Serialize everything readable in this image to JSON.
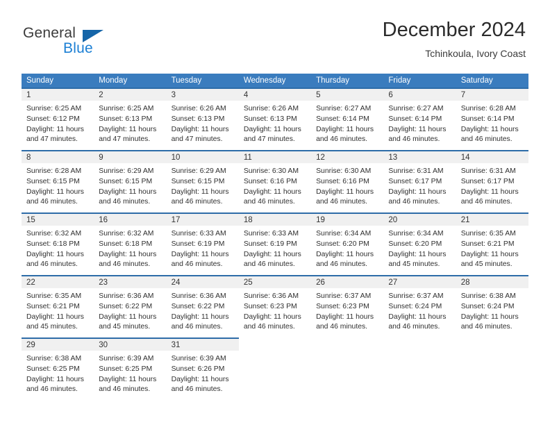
{
  "brand": {
    "name_part1": "General",
    "name_part2": "Blue",
    "logo_icon": "triangle-icon",
    "accent_color": "#1b7fd4",
    "logo_color": "#1565a8"
  },
  "header": {
    "title": "December 2024",
    "subtitle": "Tchinkoula, Ivory Coast"
  },
  "theme": {
    "header_row_bg": "#3a7cbe",
    "row_top_border": "#2d6ca8",
    "daynum_bg": "#f0f0f0",
    "text_color": "#2f2f2f"
  },
  "weekday_headers": [
    "Sunday",
    "Monday",
    "Tuesday",
    "Wednesday",
    "Thursday",
    "Friday",
    "Saturday"
  ],
  "weeks": [
    [
      {
        "day": "1",
        "sunrise": "Sunrise: 6:25 AM",
        "sunset": "Sunset: 6:12 PM",
        "daylight": "Daylight: 11 hours and 47 minutes."
      },
      {
        "day": "2",
        "sunrise": "Sunrise: 6:25 AM",
        "sunset": "Sunset: 6:13 PM",
        "daylight": "Daylight: 11 hours and 47 minutes."
      },
      {
        "day": "3",
        "sunrise": "Sunrise: 6:26 AM",
        "sunset": "Sunset: 6:13 PM",
        "daylight": "Daylight: 11 hours and 47 minutes."
      },
      {
        "day": "4",
        "sunrise": "Sunrise: 6:26 AM",
        "sunset": "Sunset: 6:13 PM",
        "daylight": "Daylight: 11 hours and 47 minutes."
      },
      {
        "day": "5",
        "sunrise": "Sunrise: 6:27 AM",
        "sunset": "Sunset: 6:14 PM",
        "daylight": "Daylight: 11 hours and 46 minutes."
      },
      {
        "day": "6",
        "sunrise": "Sunrise: 6:27 AM",
        "sunset": "Sunset: 6:14 PM",
        "daylight": "Daylight: 11 hours and 46 minutes."
      },
      {
        "day": "7",
        "sunrise": "Sunrise: 6:28 AM",
        "sunset": "Sunset: 6:14 PM",
        "daylight": "Daylight: 11 hours and 46 minutes."
      }
    ],
    [
      {
        "day": "8",
        "sunrise": "Sunrise: 6:28 AM",
        "sunset": "Sunset: 6:15 PM",
        "daylight": "Daylight: 11 hours and 46 minutes."
      },
      {
        "day": "9",
        "sunrise": "Sunrise: 6:29 AM",
        "sunset": "Sunset: 6:15 PM",
        "daylight": "Daylight: 11 hours and 46 minutes."
      },
      {
        "day": "10",
        "sunrise": "Sunrise: 6:29 AM",
        "sunset": "Sunset: 6:15 PM",
        "daylight": "Daylight: 11 hours and 46 minutes."
      },
      {
        "day": "11",
        "sunrise": "Sunrise: 6:30 AM",
        "sunset": "Sunset: 6:16 PM",
        "daylight": "Daylight: 11 hours and 46 minutes."
      },
      {
        "day": "12",
        "sunrise": "Sunrise: 6:30 AM",
        "sunset": "Sunset: 6:16 PM",
        "daylight": "Daylight: 11 hours and 46 minutes."
      },
      {
        "day": "13",
        "sunrise": "Sunrise: 6:31 AM",
        "sunset": "Sunset: 6:17 PM",
        "daylight": "Daylight: 11 hours and 46 minutes."
      },
      {
        "day": "14",
        "sunrise": "Sunrise: 6:31 AM",
        "sunset": "Sunset: 6:17 PM",
        "daylight": "Daylight: 11 hours and 46 minutes."
      }
    ],
    [
      {
        "day": "15",
        "sunrise": "Sunrise: 6:32 AM",
        "sunset": "Sunset: 6:18 PM",
        "daylight": "Daylight: 11 hours and 46 minutes."
      },
      {
        "day": "16",
        "sunrise": "Sunrise: 6:32 AM",
        "sunset": "Sunset: 6:18 PM",
        "daylight": "Daylight: 11 hours and 46 minutes."
      },
      {
        "day": "17",
        "sunrise": "Sunrise: 6:33 AM",
        "sunset": "Sunset: 6:19 PM",
        "daylight": "Daylight: 11 hours and 46 minutes."
      },
      {
        "day": "18",
        "sunrise": "Sunrise: 6:33 AM",
        "sunset": "Sunset: 6:19 PM",
        "daylight": "Daylight: 11 hours and 46 minutes."
      },
      {
        "day": "19",
        "sunrise": "Sunrise: 6:34 AM",
        "sunset": "Sunset: 6:20 PM",
        "daylight": "Daylight: 11 hours and 46 minutes."
      },
      {
        "day": "20",
        "sunrise": "Sunrise: 6:34 AM",
        "sunset": "Sunset: 6:20 PM",
        "daylight": "Daylight: 11 hours and 45 minutes."
      },
      {
        "day": "21",
        "sunrise": "Sunrise: 6:35 AM",
        "sunset": "Sunset: 6:21 PM",
        "daylight": "Daylight: 11 hours and 45 minutes."
      }
    ],
    [
      {
        "day": "22",
        "sunrise": "Sunrise: 6:35 AM",
        "sunset": "Sunset: 6:21 PM",
        "daylight": "Daylight: 11 hours and 45 minutes."
      },
      {
        "day": "23",
        "sunrise": "Sunrise: 6:36 AM",
        "sunset": "Sunset: 6:22 PM",
        "daylight": "Daylight: 11 hours and 45 minutes."
      },
      {
        "day": "24",
        "sunrise": "Sunrise: 6:36 AM",
        "sunset": "Sunset: 6:22 PM",
        "daylight": "Daylight: 11 hours and 46 minutes."
      },
      {
        "day": "25",
        "sunrise": "Sunrise: 6:36 AM",
        "sunset": "Sunset: 6:23 PM",
        "daylight": "Daylight: 11 hours and 46 minutes."
      },
      {
        "day": "26",
        "sunrise": "Sunrise: 6:37 AM",
        "sunset": "Sunset: 6:23 PM",
        "daylight": "Daylight: 11 hours and 46 minutes."
      },
      {
        "day": "27",
        "sunrise": "Sunrise: 6:37 AM",
        "sunset": "Sunset: 6:24 PM",
        "daylight": "Daylight: 11 hours and 46 minutes."
      },
      {
        "day": "28",
        "sunrise": "Sunrise: 6:38 AM",
        "sunset": "Sunset: 6:24 PM",
        "daylight": "Daylight: 11 hours and 46 minutes."
      }
    ],
    [
      {
        "day": "29",
        "sunrise": "Sunrise: 6:38 AM",
        "sunset": "Sunset: 6:25 PM",
        "daylight": "Daylight: 11 hours and 46 minutes."
      },
      {
        "day": "30",
        "sunrise": "Sunrise: 6:39 AM",
        "sunset": "Sunset: 6:25 PM",
        "daylight": "Daylight: 11 hours and 46 minutes."
      },
      {
        "day": "31",
        "sunrise": "Sunrise: 6:39 AM",
        "sunset": "Sunset: 6:26 PM",
        "daylight": "Daylight: 11 hours and 46 minutes."
      },
      null,
      null,
      null,
      null
    ]
  ]
}
